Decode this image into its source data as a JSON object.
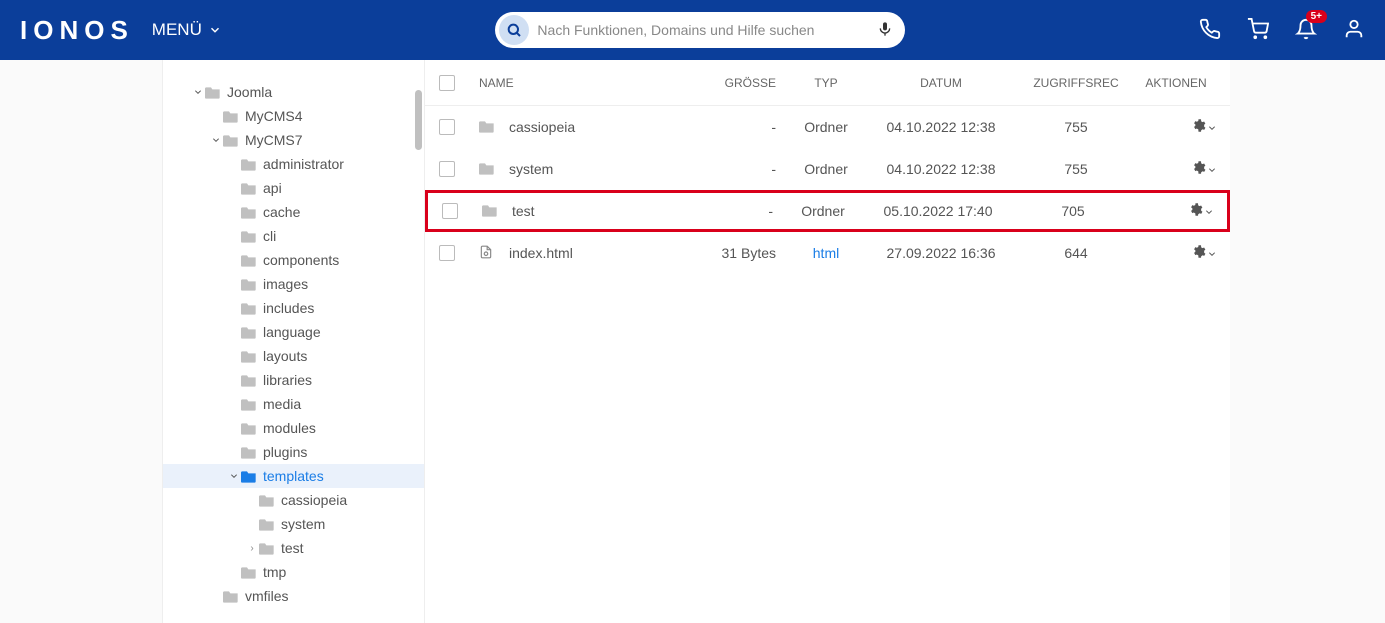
{
  "header": {
    "logo": "IONOS",
    "menu": "MENÜ",
    "search_placeholder": "Nach Funktionen, Domains und Hilfe suchen",
    "notification_badge": "5+"
  },
  "tree": [
    {
      "label": "Joomla",
      "indent": 0,
      "chevron": "down",
      "icon": "folder"
    },
    {
      "label": "MyCMS4",
      "indent": 1,
      "chevron": "",
      "icon": "folder"
    },
    {
      "label": "MyCMS7",
      "indent": 1,
      "chevron": "down",
      "icon": "folder"
    },
    {
      "label": "administrator",
      "indent": 2,
      "chevron": "",
      "icon": "folder"
    },
    {
      "label": "api",
      "indent": 2,
      "chevron": "",
      "icon": "folder"
    },
    {
      "label": "cache",
      "indent": 2,
      "chevron": "",
      "icon": "folder"
    },
    {
      "label": "cli",
      "indent": 2,
      "chevron": "",
      "icon": "folder"
    },
    {
      "label": "components",
      "indent": 2,
      "chevron": "",
      "icon": "folder"
    },
    {
      "label": "images",
      "indent": 2,
      "chevron": "",
      "icon": "folder"
    },
    {
      "label": "includes",
      "indent": 2,
      "chevron": "",
      "icon": "folder"
    },
    {
      "label": "language",
      "indent": 2,
      "chevron": "",
      "icon": "folder"
    },
    {
      "label": "layouts",
      "indent": 2,
      "chevron": "",
      "icon": "folder"
    },
    {
      "label": "libraries",
      "indent": 2,
      "chevron": "",
      "icon": "folder"
    },
    {
      "label": "media",
      "indent": 2,
      "chevron": "",
      "icon": "folder"
    },
    {
      "label": "modules",
      "indent": 2,
      "chevron": "",
      "icon": "folder"
    },
    {
      "label": "plugins",
      "indent": 2,
      "chevron": "",
      "icon": "folder"
    },
    {
      "label": "templates",
      "indent": 2,
      "chevron": "down",
      "icon": "folder",
      "active": true
    },
    {
      "label": "cassiopeia",
      "indent": 3,
      "chevron": "",
      "icon": "folder"
    },
    {
      "label": "system",
      "indent": 3,
      "chevron": "",
      "icon": "folder"
    },
    {
      "label": "test",
      "indent": 3,
      "chevron": "right",
      "icon": "folder"
    },
    {
      "label": "tmp",
      "indent": 2,
      "chevron": "",
      "icon": "folder"
    },
    {
      "label": "vmfiles",
      "indent": 1,
      "chevron": "",
      "icon": "folder"
    }
  ],
  "table": {
    "headers": {
      "name": "NAME",
      "size": "GRÖSSE",
      "type": "TYP",
      "date": "DATUM",
      "perm": "ZUGRIFFSREC",
      "action": "AKTIONEN"
    },
    "rows": [
      {
        "name": "cassiopeia",
        "icon": "folder",
        "size": "-",
        "type": "Ordner",
        "date": "04.10.2022 12:38",
        "perm": "755",
        "highlight": false
      },
      {
        "name": "system",
        "icon": "folder",
        "size": "-",
        "type": "Ordner",
        "date": "04.10.2022 12:38",
        "perm": "755",
        "highlight": false
      },
      {
        "name": "test",
        "icon": "folder",
        "size": "-",
        "type": "Ordner",
        "date": "05.10.2022 17:40",
        "perm": "705",
        "highlight": true
      },
      {
        "name": "index.html",
        "icon": "file",
        "size": "31 Bytes",
        "type": "html",
        "type_link": true,
        "date": "27.09.2022 16:36",
        "perm": "644",
        "highlight": false
      }
    ]
  }
}
